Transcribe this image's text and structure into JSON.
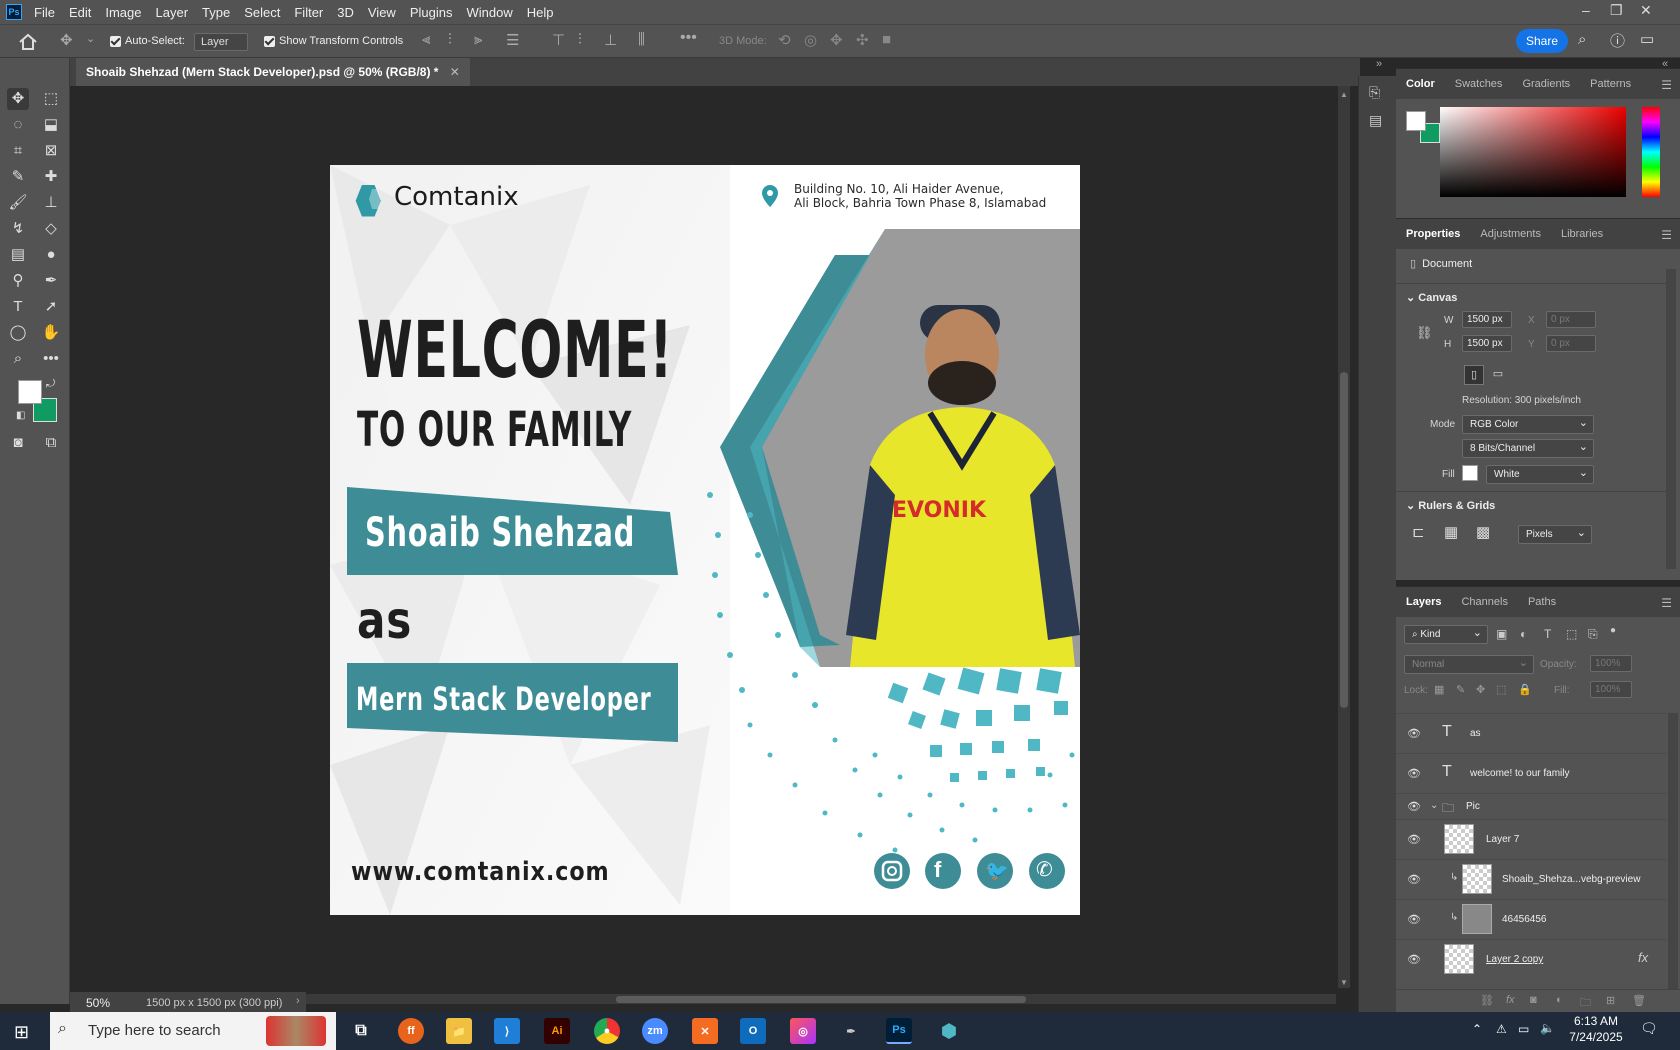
{
  "menubar": {
    "app_badge": "Ps",
    "items": [
      "File",
      "Edit",
      "Image",
      "Layer",
      "Type",
      "Select",
      "Filter",
      "3D",
      "View",
      "Plugins",
      "Window",
      "Help"
    ]
  },
  "options": {
    "auto_select_label": "Auto-Select:",
    "auto_select_value": "Layer",
    "transform_label": "Show Transform Controls",
    "mode_3d_label": "3D Mode:",
    "share_label": "Share"
  },
  "document": {
    "tab_title": "Shoaib Shehzad (Mern Stack Developer).psd @ 50% (RGB/8) *",
    "zoom": "50%",
    "doc_info": "1500 px x 1500 px (300 ppi)"
  },
  "artwork": {
    "brand": "Comtanix",
    "address_line1": "Building No. 10, Ali Haider Avenue,",
    "address_line2": "Ali Block, Bahria Town Phase 8, Islamabad",
    "headline": "WELCOME!",
    "subheadline": "TO OUR FAMILY",
    "name": "Shoaib Shehzad",
    "connector": "as",
    "role": "Mern Stack Developer",
    "website": "www.comtanix.com",
    "jersey_text": "EVONIK",
    "colors": {
      "teal": "#3d8c96",
      "teal_light": "#4fb8c4",
      "jersey": "#e8e62a"
    }
  },
  "color_panel": {
    "tabs": [
      "Color",
      "Swatches",
      "Gradients",
      "Patterns"
    ],
    "foreground": "#ffffff",
    "background": "#0f9b62"
  },
  "properties": {
    "tabs": [
      "Properties",
      "Adjustments",
      "Libraries"
    ],
    "doc_label": "Document",
    "canvas_header": "Canvas",
    "w_label": "W",
    "w_value": "1500 px",
    "h_label": "H",
    "h_value": "1500 px",
    "x_label": "X",
    "x_value": "0 px",
    "y_label": "Y",
    "y_value": "0 px",
    "resolution": "Resolution: 300 pixels/inch",
    "mode_label": "Mode",
    "mode_value": "RGB Color",
    "bits_value": "8 Bits/Channel",
    "fill_label": "Fill",
    "fill_value": "White",
    "rulers_header": "Rulers & Grids",
    "units_value": "Pixels"
  },
  "layers_panel": {
    "tabs": [
      "Layers",
      "Channels",
      "Paths"
    ],
    "kind_label": "Kind",
    "blend_mode": "Normal",
    "opacity_label": "Opacity:",
    "opacity_value": "100%",
    "lock_label": "Lock:",
    "fill_label": "Fill:",
    "fill_value": "100%",
    "layers": [
      {
        "name": "as",
        "type": "text"
      },
      {
        "name": "welcome!  to our family",
        "type": "text"
      },
      {
        "name": "Pic",
        "type": "group"
      },
      {
        "name": "Layer 7",
        "type": "pixel"
      },
      {
        "name": "Shoaib_Shehza...vebg-preview",
        "type": "smart"
      },
      {
        "name": "46456456",
        "type": "smart"
      },
      {
        "name": "Layer 2 copy",
        "type": "pixel"
      }
    ]
  },
  "taskbar": {
    "search_placeholder": "Type here to search",
    "time": "6:13 AM",
    "date": "7/24/2025"
  }
}
